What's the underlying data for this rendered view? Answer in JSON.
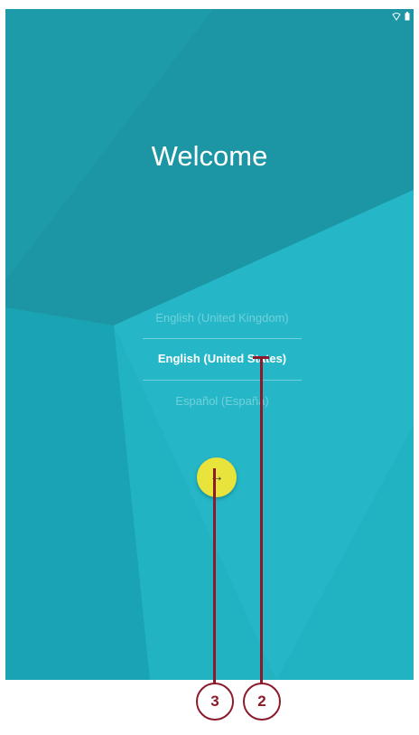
{
  "welcome": {
    "title": "Welcome"
  },
  "languages": {
    "items": [
      {
        "label": "English (United Kingdom)"
      },
      {
        "label": "English (United States)",
        "selected": true
      },
      {
        "label": "Español (España)"
      }
    ]
  },
  "next_button": {
    "icon": "arrow-right-icon",
    "glyph": "→",
    "color": "#e8e43c"
  },
  "status_bar": {
    "icons": [
      "wifi-icon",
      "battery-icon"
    ]
  },
  "callouts": [
    {
      "label": "3"
    },
    {
      "label": "2"
    }
  ],
  "colors": {
    "background": "#1aa4b3",
    "accent": "#e8e43c",
    "callout": "#8b1a2b"
  }
}
